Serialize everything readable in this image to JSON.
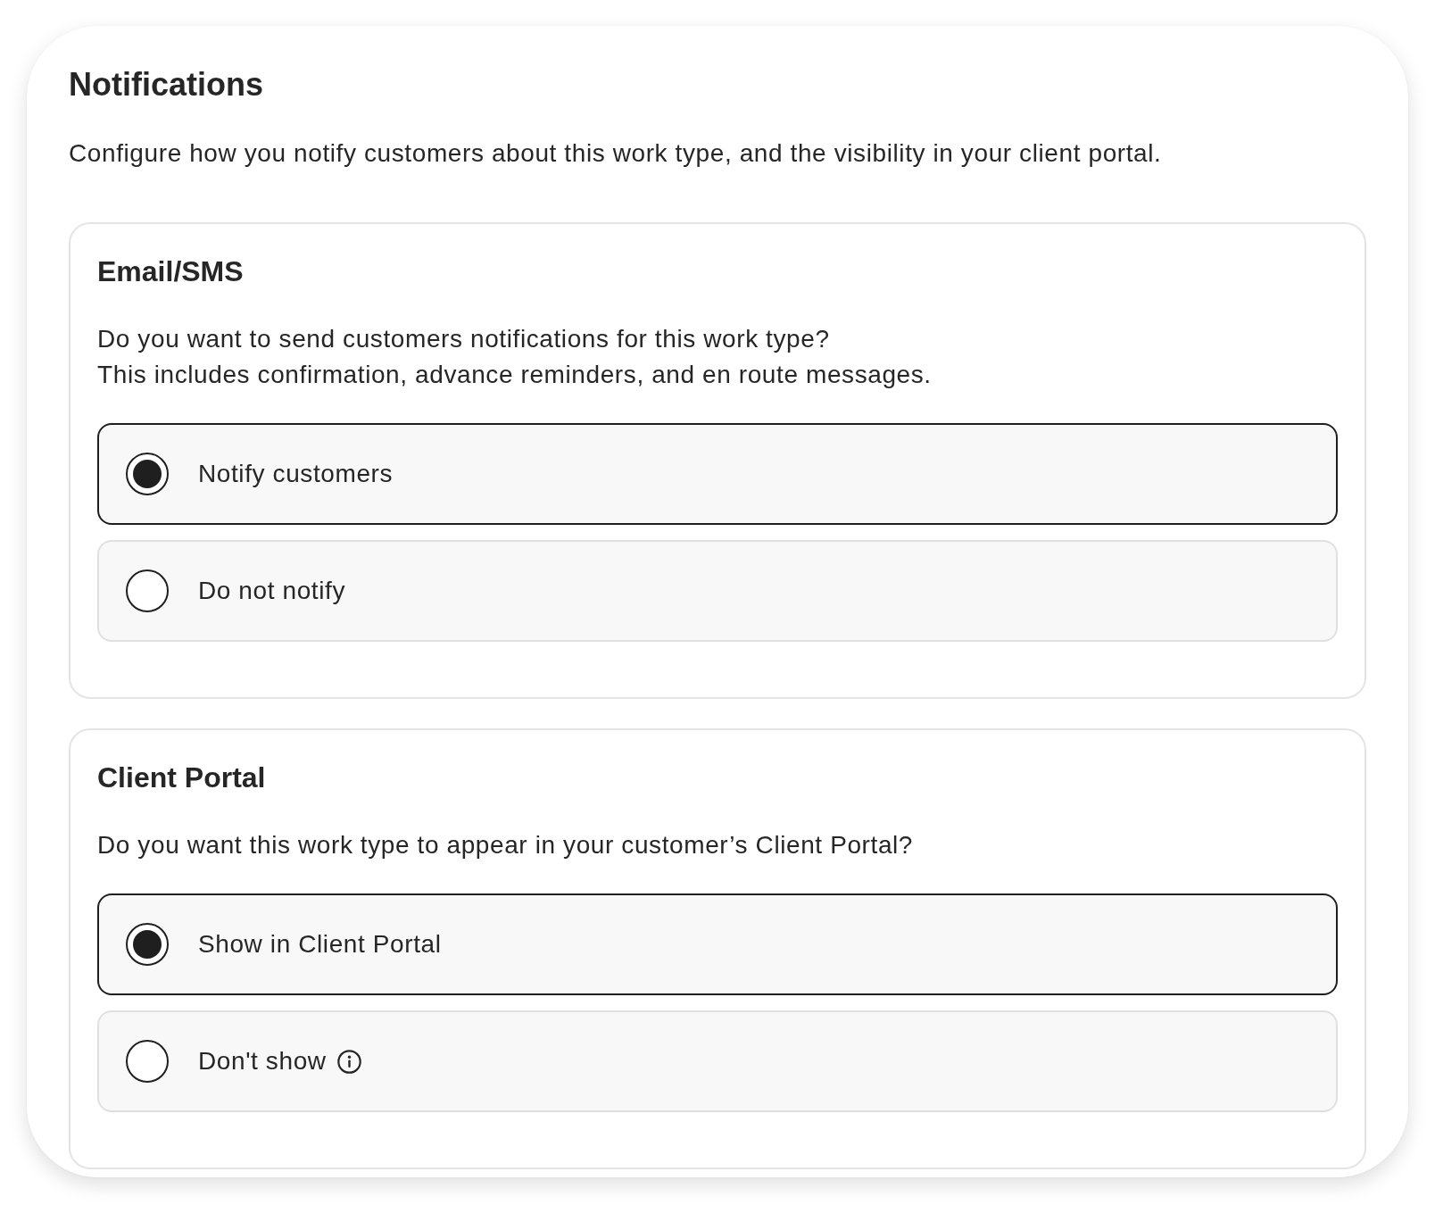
{
  "title": "Notifications",
  "description": "Configure how you notify customers about this work type, and the visibility in your client portal.",
  "sections": [
    {
      "heading": "Email/SMS",
      "question": [
        "Do you want to send customers notifications for this work type?",
        "This includes confirmation, advance reminders, and en route messages."
      ],
      "options": [
        {
          "label": "Notify customers",
          "selected": true,
          "info": false
        },
        {
          "label": "Do not notify",
          "selected": false,
          "info": false
        }
      ]
    },
    {
      "heading": "Client Portal",
      "question": [
        "Do you want this work type to appear in your customer’s Client Portal?"
      ],
      "options": [
        {
          "label": "Show in Client Portal",
          "selected": true,
          "info": false
        },
        {
          "label": "Don't show",
          "selected": false,
          "info": true
        }
      ]
    }
  ]
}
